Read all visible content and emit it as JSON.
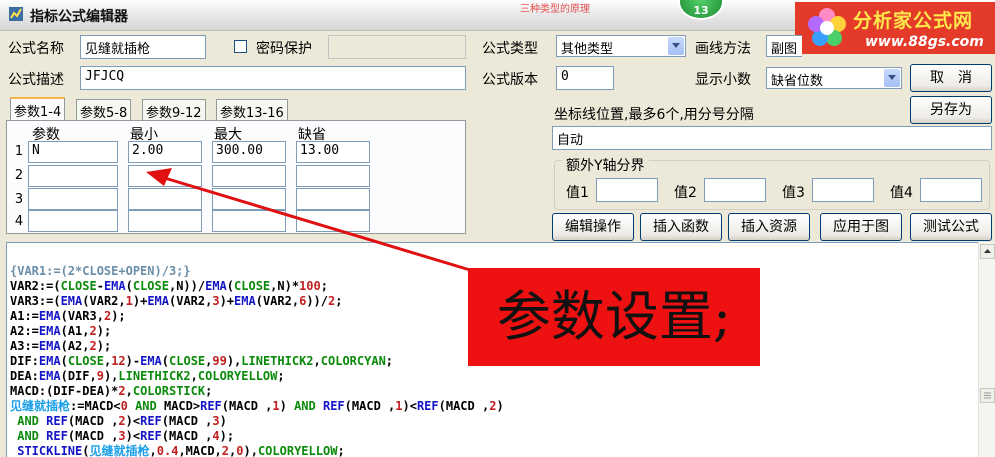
{
  "window": {
    "title": "指标公式编辑器",
    "top_badge": "13",
    "top_red_text": "三种类型的原理"
  },
  "logo": {
    "name": "分析家公式网",
    "url": "www.88gs.com"
  },
  "form": {
    "name_label": "公式名称",
    "name_value": "见缝就插枪",
    "password_label": "密码保护",
    "password_checked": false,
    "desc_label": "公式描述",
    "desc_value": "JFJCQ",
    "type_label": "公式类型",
    "type_value": "其他类型",
    "version_label": "公式版本",
    "version_value": "0",
    "draw_label": "画线方法",
    "draw_value": "副图",
    "decimals_label": "显示小数",
    "decimals_value": "缺省位数"
  },
  "buttons": {
    "cancel": "取　消",
    "save_as": "另存为",
    "edit_ops": "编辑操作",
    "insert_func": "插入函数",
    "insert_res": "插入资源",
    "apply_chart": "应用于图",
    "test": "测试公式"
  },
  "tabs": [
    "参数1-4",
    "参数5-8",
    "参数9-12",
    "参数13-16"
  ],
  "params": {
    "headers": [
      "参数",
      "最小",
      "最大",
      "缺省"
    ],
    "row_numbers": [
      "1",
      "2",
      "3",
      "4"
    ],
    "rows": [
      [
        "N",
        "2.00",
        "300.00",
        "13.00"
      ],
      [
        "",
        "",
        "",
        ""
      ],
      [
        "",
        "",
        "",
        ""
      ],
      [
        "",
        "",
        "",
        ""
      ]
    ]
  },
  "axis": {
    "label": "坐标线位置,最多6个,用分号分隔",
    "value": "自动"
  },
  "extra_y": {
    "legend": "额外Y轴分界",
    "labels": [
      "值1",
      "值2",
      "值3",
      "值4"
    ],
    "values": [
      "",
      "",
      "",
      ""
    ]
  },
  "callout_text": "参数设置;",
  "code_lines": [
    "{VAR1:=(2*CLOSE+OPEN)/3;}",
    "VAR2:=(CLOSE-EMA(CLOSE,N))/EMA(CLOSE,N)*100;",
    "VAR3:=(EMA(VAR2,1)+EMA(VAR2,3)+EMA(VAR2,6))/2;",
    "A1:=EMA(VAR3,2);",
    "A2:=EMA(A1,2);",
    "A3:=EMA(A2,2);",
    "DIF:EMA(CLOSE,12)-EMA(CLOSE,99),LINETHICK2,COLORCYAN;",
    "DEA:EMA(DIF,9),LINETHICK2,COLORYELLOW;",
    "MACD:(DIF-DEA)*2,COLORSTICK;",
    "见缝就插枪:=MACD<0 AND MACD>REF(MACD ,1) AND REF(MACD ,1)<REF(MACD ,2)",
    " AND REF(MACD ,2)<REF(MACD ,3)",
    " AND REF(MACD ,3)<REF(MACD ,4);",
    " STICKLINE(见缝就插枪,0.4,MACD,2,0),COLORYELLOW;"
  ],
  "colors": {
    "callout": "#ee1111",
    "arrow": "#e01010",
    "logo_bg": "#e43a2a"
  }
}
